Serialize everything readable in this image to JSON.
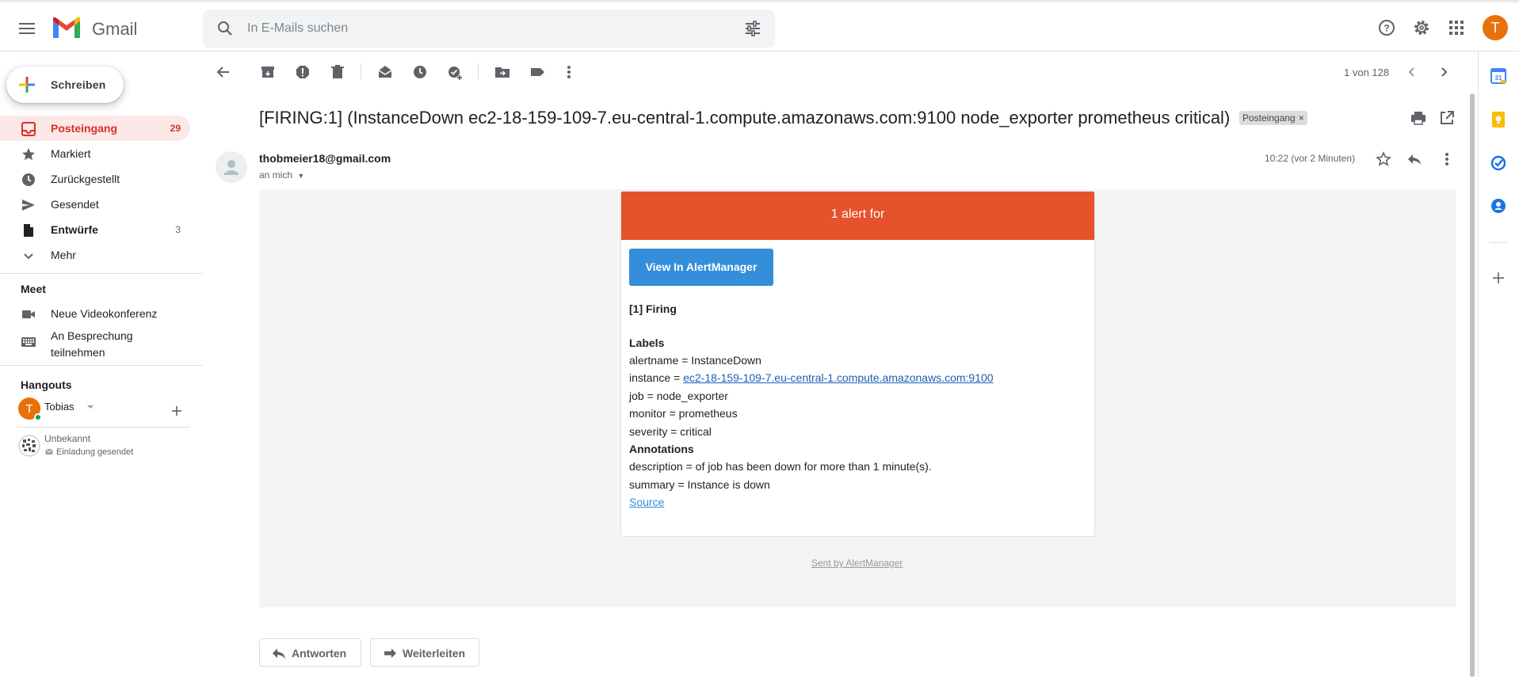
{
  "header": {
    "app_name": "Gmail",
    "search_placeholder": "In E-Mails suchen",
    "avatar_letter": "T"
  },
  "sidebar": {
    "compose_label": "Schreiben",
    "items": [
      {
        "label": "Posteingang",
        "count": "29",
        "icon": "inbox-icon"
      },
      {
        "label": "Markiert",
        "count": "",
        "icon": "star-icon"
      },
      {
        "label": "Zurückgestellt",
        "count": "",
        "icon": "clock-icon"
      },
      {
        "label": "Gesendet",
        "count": "",
        "icon": "send-icon"
      },
      {
        "label": "Entwürfe",
        "count": "3",
        "icon": "draft-icon"
      },
      {
        "label": "Mehr",
        "count": "",
        "icon": "chevron-down-icon"
      }
    ],
    "meet": {
      "title": "Meet",
      "new_meeting": "Neue Videokonferenz",
      "join_meeting_line1": "An Besprechung",
      "join_meeting_line2": "teilnehmen"
    },
    "hangouts": {
      "title": "Hangouts",
      "user_letter": "T",
      "user_name": "Tobias",
      "contact_name": "Unbekannt",
      "contact_status": "Einladung gesendet"
    }
  },
  "toolbar": {
    "pager": "1 von 128"
  },
  "message": {
    "subject": "[FIRING:1] (InstanceDown ec2-18-159-109-7.eu-central-1.compute.amazonaws.com:9100 node_exporter prometheus critical)",
    "label_chip": "Posteingang",
    "label_chip_close": "×",
    "sender": "thobmeier18@gmail.com",
    "recipient": "an mich",
    "time": "10:22 (vor 2 Minuten)"
  },
  "email": {
    "header": "1 alert for",
    "button": "View In AlertManager",
    "firing": "[1] Firing",
    "labels_title": "Labels",
    "alertname": "alertname = InstanceDown",
    "instance_prefix": "instance = ",
    "instance_link": "ec2-18-159-109-7.eu-central-1.compute.amazonaws.com:9100",
    "job": "job = node_exporter",
    "monitor": "monitor = prometheus",
    "severity": "severity = critical",
    "annotations_title": "Annotations",
    "description": "description = of job has been down for more than 1 minute(s).",
    "summary": "summary = Instance is down",
    "source": "Source",
    "footer": "Sent by AlertManager"
  },
  "actions": {
    "reply": "Antworten",
    "forward": "Weiterleiten"
  },
  "colors": {
    "alert_header": "#e6522c",
    "alert_button": "#348eda",
    "gmail_red": "#d93025",
    "avatar": "#e8710a"
  }
}
